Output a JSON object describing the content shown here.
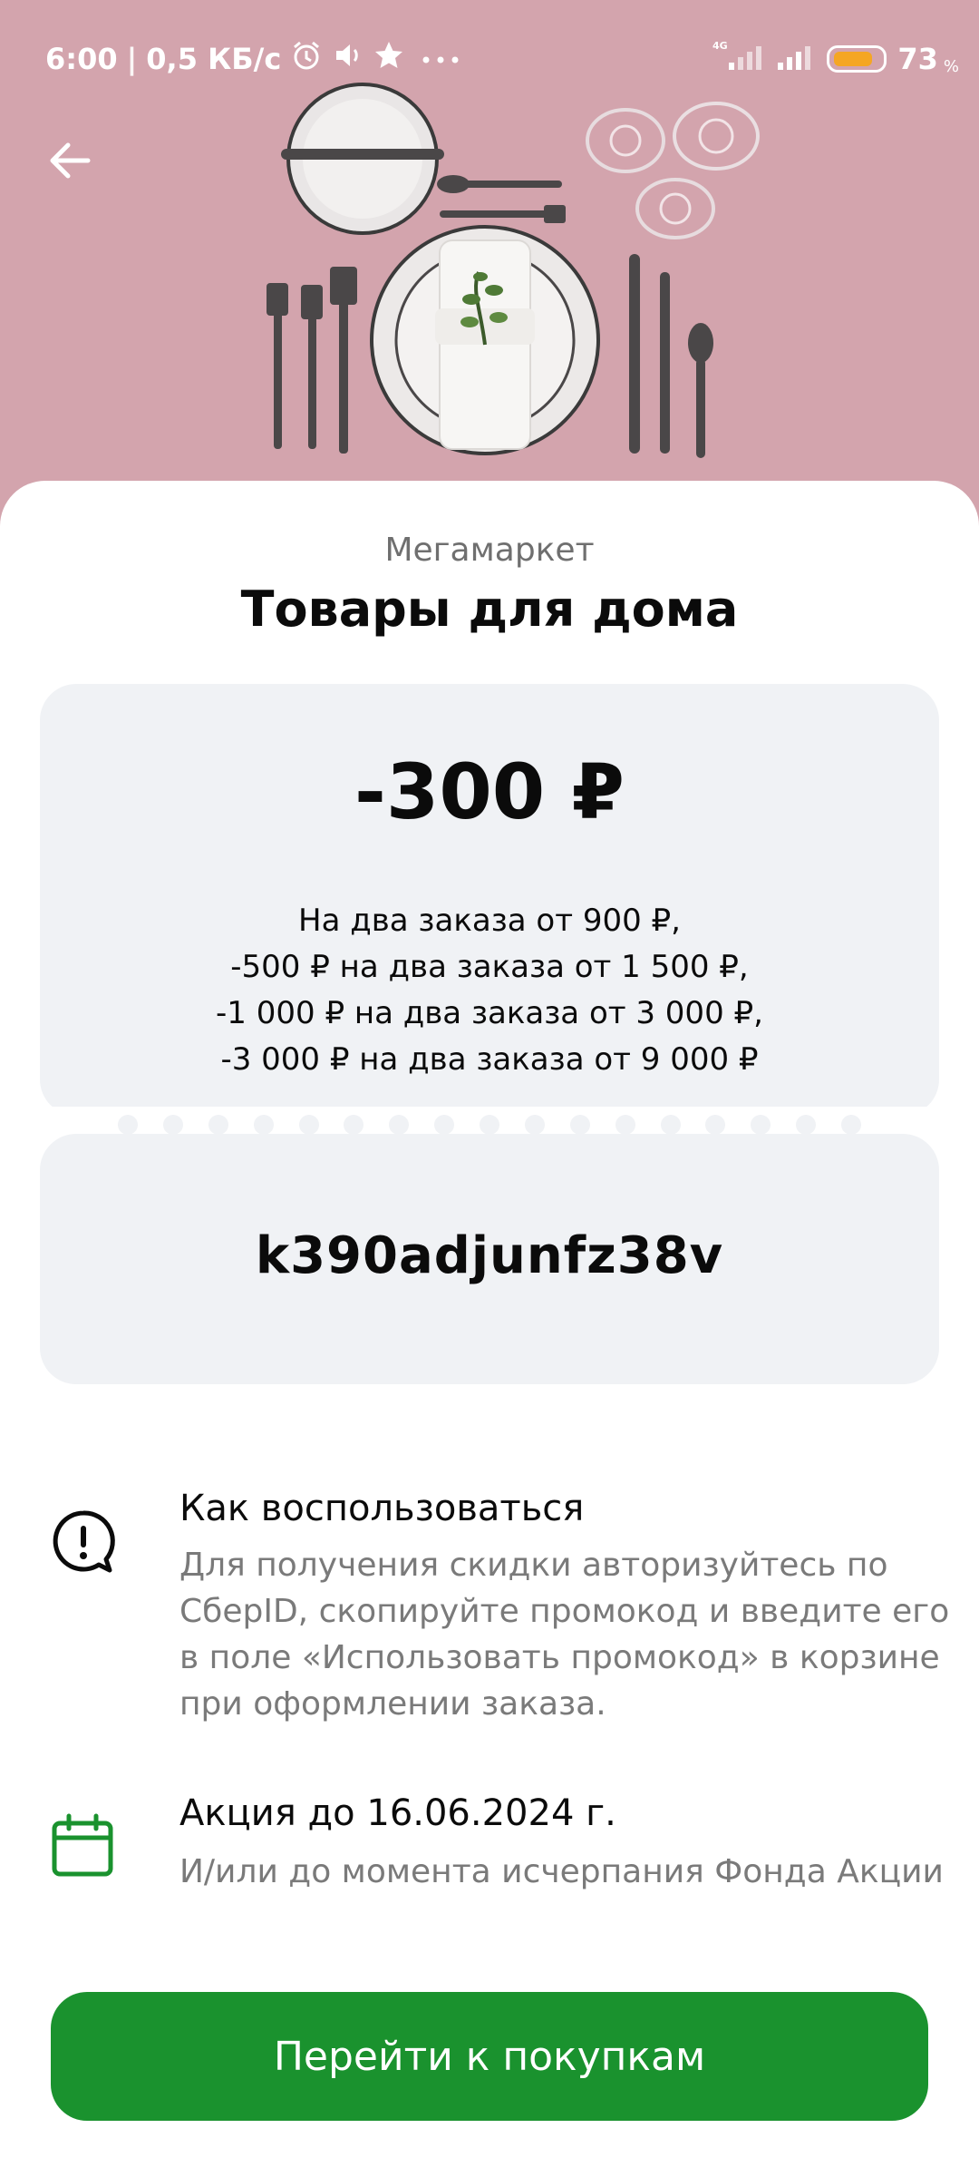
{
  "status_bar": {
    "time": "6:00",
    "separator": "|",
    "speed": "0,5 КБ/с",
    "icons": [
      "alarm-icon",
      "volume-icon",
      "star-icon",
      "more-dots-icon"
    ],
    "network": "4G",
    "battery_level": 0.73,
    "battery_percent": "73",
    "battery_percent_sign": "%"
  },
  "hero": {
    "image": "table-setting-photo",
    "background_color": "#d3a4ad"
  },
  "header": {
    "back_icon": "arrow-left-icon"
  },
  "offer": {
    "brand": "Мегамаркет",
    "title": "Товары для дома",
    "discount": "-300 ₽",
    "conditions": [
      "На два заказа от 900 ₽,",
      "-500 ₽ на два заказа от 1 500 ₽,",
      "-1 000 ₽ на два заказа от 3 000 ₽,",
      "-3 000 ₽ на два заказа от 9 000 ₽"
    ],
    "promo_code": "k390adjunfz38v"
  },
  "how_to": {
    "icon": "alert-bubble-icon",
    "title": "Как воспользоваться",
    "lines": [
      "Для получения скидки авторизуйтесь по",
      "СберID, скопируйте промокод и введите его",
      "в поле «Использовать промокод» в корзине",
      "при оформлении заказа."
    ]
  },
  "validity": {
    "icon": "calendar-icon",
    "title": "Акция до 16.06.2024 г.",
    "text": "И/или до момента исчерпания Фонда Акции"
  },
  "cta": {
    "label": "Перейти к покупкам"
  },
  "colors": {
    "accent": "#1a922e",
    "card_bg": "#f0f2f5",
    "muted_text": "#7a7a7a"
  }
}
